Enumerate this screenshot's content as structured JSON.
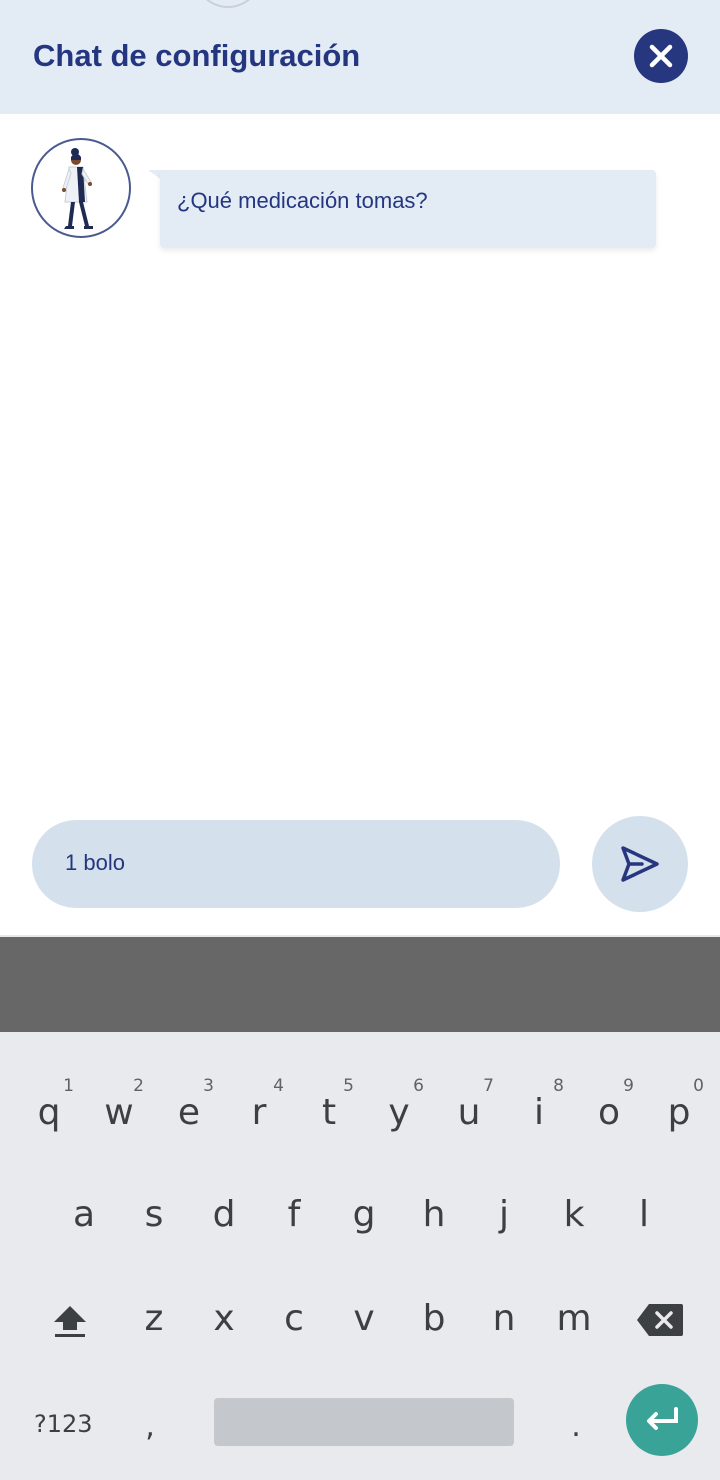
{
  "header": {
    "title": "Chat de configuración",
    "close_icon": "close-icon",
    "accent_color": "#253680",
    "background_color": "#e3ebf4"
  },
  "chat": {
    "messages": [
      {
        "sender": "bot",
        "avatar": "doctor-avatar-icon",
        "text": "¿Qué medicación tomas?"
      }
    ]
  },
  "composer": {
    "input_value": "1 bolo",
    "send_icon": "send-icon"
  },
  "keyboard": {
    "row1": [
      {
        "key": "q",
        "hint": "1"
      },
      {
        "key": "w",
        "hint": "2"
      },
      {
        "key": "e",
        "hint": "3"
      },
      {
        "key": "r",
        "hint": "4"
      },
      {
        "key": "t",
        "hint": "5"
      },
      {
        "key": "y",
        "hint": "6"
      },
      {
        "key": "u",
        "hint": "7"
      },
      {
        "key": "i",
        "hint": "8"
      },
      {
        "key": "o",
        "hint": "9"
      },
      {
        "key": "p",
        "hint": "0"
      }
    ],
    "row2": [
      "a",
      "s",
      "d",
      "f",
      "g",
      "h",
      "j",
      "k",
      "l"
    ],
    "row3": [
      "z",
      "x",
      "c",
      "v",
      "b",
      "n",
      "m"
    ],
    "symbols_label": "?123",
    "comma": ",",
    "period": ".",
    "shift_icon": "shift-icon",
    "backspace_icon": "backspace-icon",
    "enter_icon": "enter-icon",
    "enter_color": "#3aa397"
  }
}
